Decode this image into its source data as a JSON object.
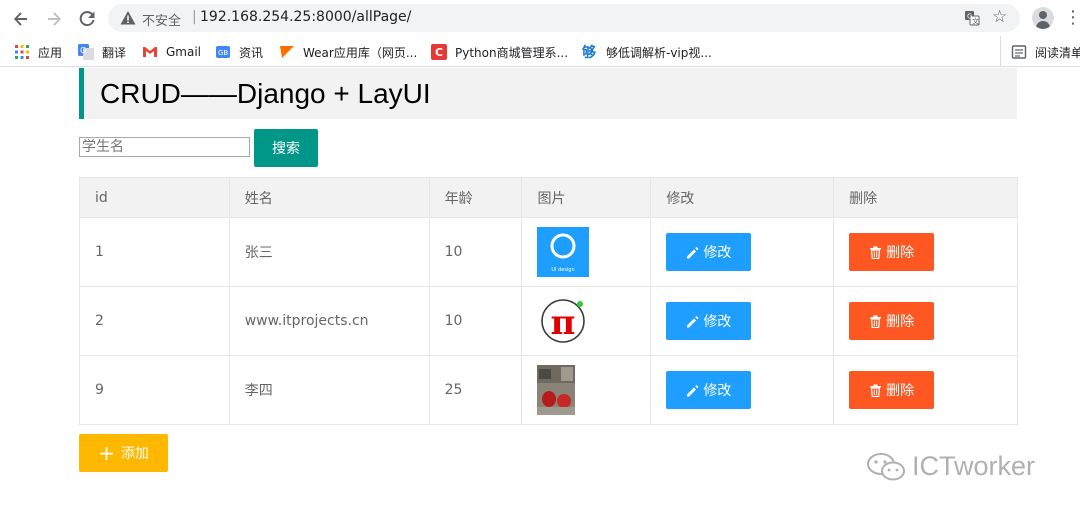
{
  "browser": {
    "security_label": "不安全",
    "separator": "|",
    "url": "192.168.254.25:8000/allPage/",
    "bookmarks": [
      {
        "label": "应用",
        "icon": "apps-grid-icon"
      },
      {
        "label": "翻译",
        "icon": "google-translate-icon"
      },
      {
        "label": "Gmail",
        "icon": "gmail-icon"
      },
      {
        "label": "资讯",
        "icon": "news-icon"
      },
      {
        "label": "Wear应用库（网页...",
        "icon": "wear-icon"
      },
      {
        "label": "Python商城管理系...",
        "icon": "c-logo-icon"
      },
      {
        "label": "够低调解析-vip视...",
        "icon": "gou-icon"
      }
    ],
    "reading_list": "阅读清单"
  },
  "page": {
    "title": "CRUD——Django + LayUI",
    "search": {
      "placeholder": "学生名",
      "value": "",
      "button": "搜索"
    },
    "table": {
      "headers": [
        "id",
        "姓名",
        "年龄",
        "图片",
        "修改",
        "删除"
      ],
      "rows": [
        {
          "id": "1",
          "name": "张三",
          "age": "10",
          "image": "ui-design-logo",
          "edit": "修改",
          "delete": "删除"
        },
        {
          "id": "2",
          "name": "www.itprojects.cn",
          "age": "10",
          "image": "pi-logo",
          "edit": "修改",
          "delete": "删除"
        },
        {
          "id": "9",
          "name": "李四",
          "age": "25",
          "image": "photo",
          "edit": "修改",
          "delete": "删除"
        }
      ]
    },
    "add_button": "添加",
    "thumb_caption": "UI design"
  },
  "watermark": "ICTworker",
  "colors": {
    "accent": "#009688",
    "edit": "#1e9fff",
    "delete": "#ff5722",
    "add": "#ffb800"
  }
}
